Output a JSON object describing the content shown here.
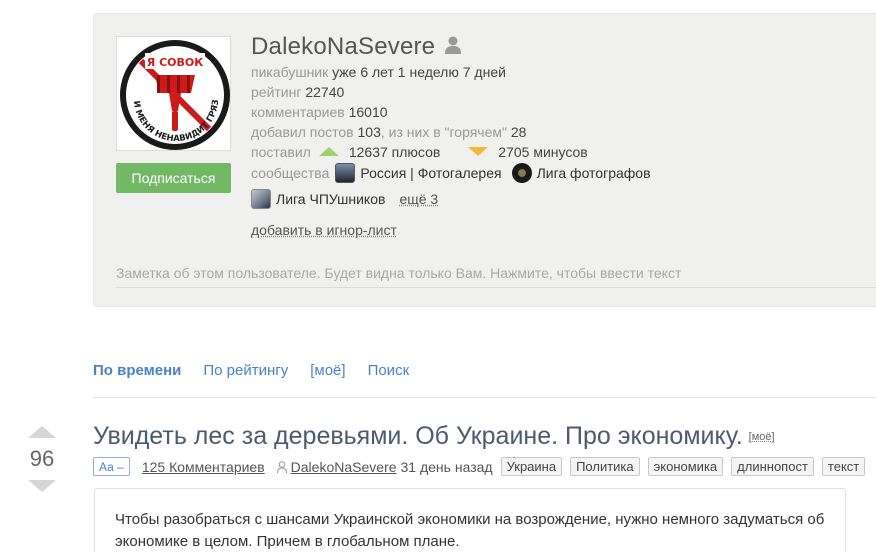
{
  "profile": {
    "avatar": {
      "top_text": "Я СОВОК",
      "ring_text": "И МЕНЯ НЕНАВИДИТ ГРЯЗЬ!",
      "colors": {
        "red": "#cc1b1b",
        "dark": "#1a1a1a"
      }
    },
    "subscribe_label": "Подписаться",
    "username": "DalekoNaSevere",
    "stats": {
      "pikabushnik_label": "пикабушник",
      "pikabushnik_value": "уже 6 лет 1 неделю 7 дней",
      "rating_label": "рейтинг",
      "rating_value": "22740",
      "comments_label": "комментариев",
      "comments_value": "16010",
      "posts_label": "добавил постов",
      "posts_value": "103",
      "hot_label": ", из них в \"горячем\"",
      "hot_value": "28",
      "votes_label": "поставил",
      "plus_value": "12637 плюсов",
      "minus_value": "2705 минусов",
      "communities_label": "сообщества"
    },
    "communities": [
      {
        "name": "Россия | Фотогалерея",
        "icon": "russia-photo-community-icon"
      },
      {
        "name": "Лига фотографов",
        "icon": "camera-lens-community-icon"
      },
      {
        "name": "Лига ЧПУшников",
        "icon": "cnc-community-icon"
      }
    ],
    "more_label": "ещё 3",
    "ignore_label": "добавить в игнор-лист",
    "note_placeholder": "Заметка об этом пользователе. Будет видна только Вам. Нажмите, чтобы ввести текст"
  },
  "tabs": [
    {
      "label": "По времени",
      "active": true
    },
    {
      "label": "По рейтингу",
      "active": false
    },
    {
      "label": "[моё]",
      "active": false
    },
    {
      "label": "Поиск",
      "active": false
    }
  ],
  "post": {
    "rating": "96",
    "title": "Увидеть лес за деревьями. Об Украине. Про экономику.",
    "my_label": "[моё]",
    "font_toggle_label": "Аа –",
    "comments_label": "125 Комментариев",
    "author": "DalekoNaSevere",
    "time": "31 день назад",
    "tags": [
      "Украина",
      "Политика",
      "экономика",
      "длиннопост",
      "текст"
    ],
    "body_text": "Чтобы разобраться с шансами Украинской экономики на возрождение, нужно немного задуматься об экономике в целом. Причем в глобальном плане."
  },
  "colors": {
    "link_blue": "#4a82c7",
    "subscribe_green": "#72b865",
    "plus_green": "#9ed36b",
    "minus_orange": "#f4b938"
  }
}
